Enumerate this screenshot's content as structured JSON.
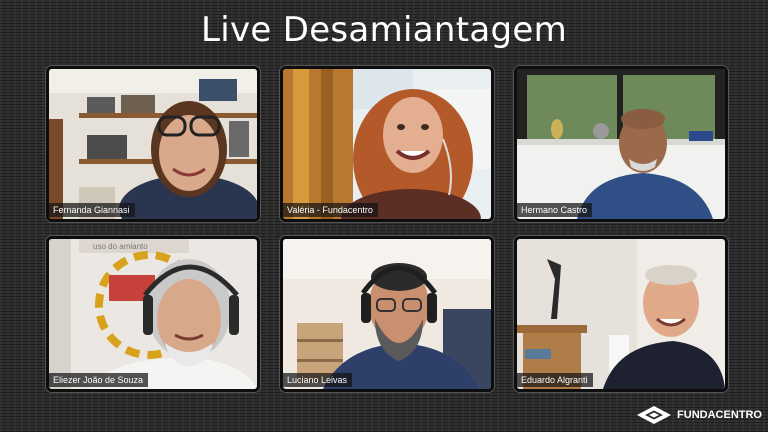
{
  "title": "Live Desamiantagem",
  "participants": [
    {
      "name": "Fernanda Giannasi"
    },
    {
      "name": "Valéria - Fundacentro"
    },
    {
      "name": "Hermano Castro"
    },
    {
      "name": "Eliezer João de Souza"
    },
    {
      "name": "Luciano Leivas"
    },
    {
      "name": "Eduardo Algranti"
    }
  ],
  "logo": {
    "text": "FUNDACENTRO",
    "icon": "fundacentro-logo-icon"
  },
  "colors": {
    "background": "#2e2e2e",
    "title": "#ffffff",
    "tile_border": "#0d0d0d"
  }
}
